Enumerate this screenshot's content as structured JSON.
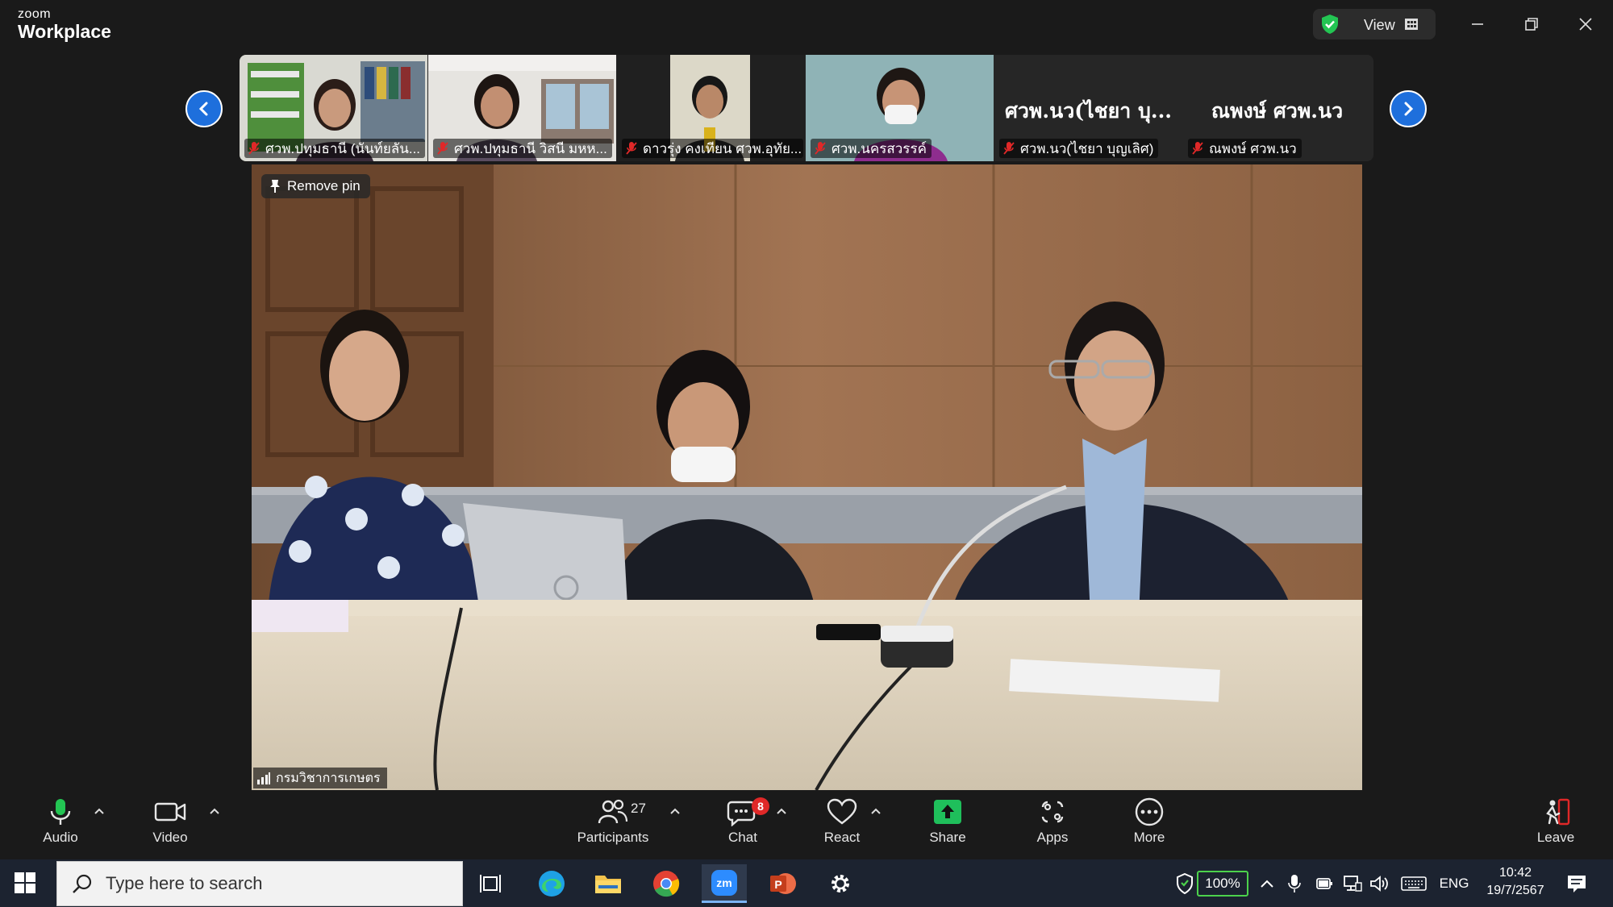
{
  "app": {
    "brand_small": "zoom",
    "brand_big": "Workplace"
  },
  "titlebar": {
    "view_label": "View"
  },
  "filmstrip": {
    "tiles": [
      {
        "name": "ศวพ.ปทุมธานี (นันท์ยลัน..."
      },
      {
        "name": "ศวพ.ปทุมธานี วิสนี มหห..."
      },
      {
        "name": "ดาวรุ่ง คงเทียน ศวพ.อุทัย..."
      },
      {
        "name": "ศวพ.นครสวรรค์"
      },
      {
        "big_label": "ศวพ.นว(ไชยา บุ...",
        "name": "ศวพ.นว(ไชยา บุญเลิศ)"
      },
      {
        "big_label": "ณพงษ์ ศวพ.นว",
        "name": "ณพงษ์ ศวพ.นว"
      }
    ]
  },
  "main_video": {
    "remove_pin_label": "Remove pin",
    "room_name": "กรมวิชาการเกษตร"
  },
  "toolbar": {
    "audio": "Audio",
    "video": "Video",
    "participants": "Participants",
    "participants_count": "27",
    "chat": "Chat",
    "chat_badge": "8",
    "react": "React",
    "share": "Share",
    "apps": "Apps",
    "more": "More",
    "leave": "Leave"
  },
  "taskbar": {
    "search_placeholder": "Type here to search",
    "battery": "100%",
    "language": "ENG",
    "time": "10:42",
    "date": "19/7/2567"
  },
  "colors": {
    "accent_blue": "#1e6fdc",
    "share_green": "#1fbf5b",
    "leave_red": "#e02828",
    "badge_red": "#e02828"
  }
}
